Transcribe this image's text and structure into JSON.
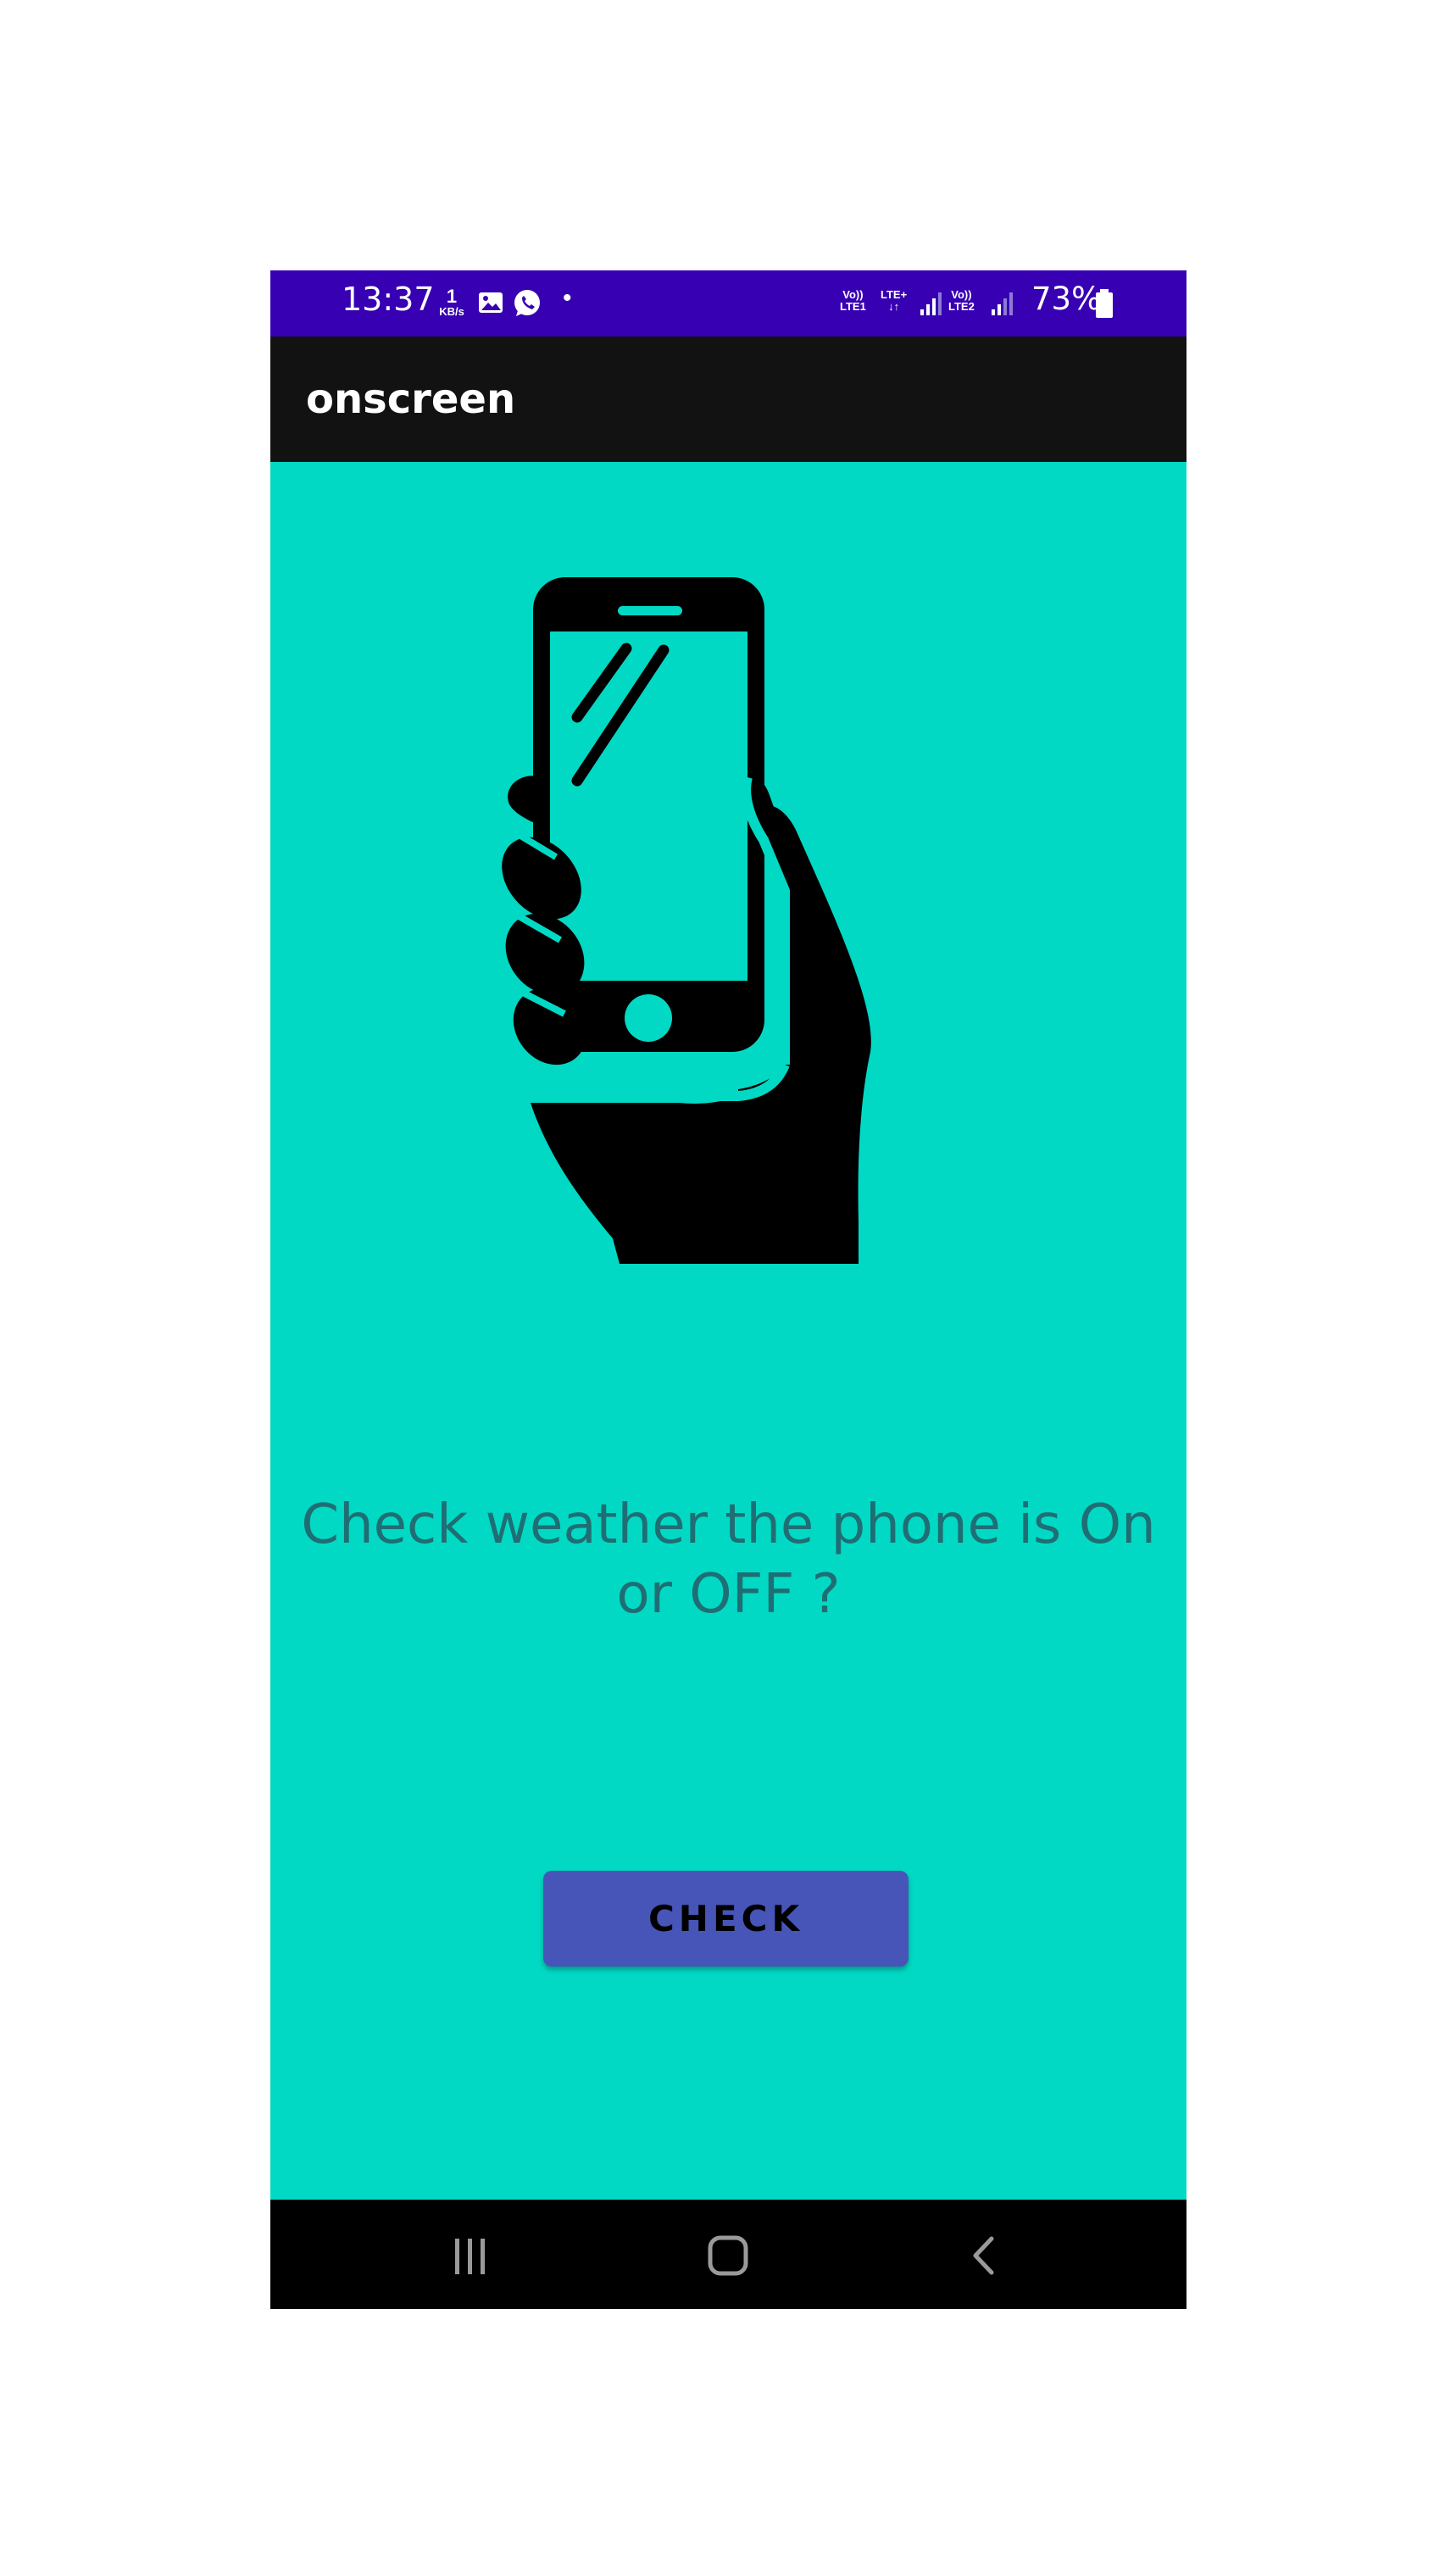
{
  "status_bar": {
    "time": "13:37",
    "net_speed_value": "1",
    "net_speed_unit": "KB/s",
    "sim1_volte": "Vo))",
    "sim1_label": "LTE1",
    "lte_plus": "LTE+",
    "sim2_volte": "Vo))",
    "sim2_label": "LTE2",
    "battery_percent": "73%",
    "colors": {
      "background": "#3700B3",
      "text": "#FFFFFF"
    },
    "icons": [
      "gallery-icon",
      "whatsapp-icon",
      "notification-dot-icon",
      "data-arrows-icon",
      "signal-icon",
      "battery-icon"
    ]
  },
  "app_bar": {
    "title": "onscreen",
    "background": "#121212"
  },
  "main": {
    "background": "#02D9C4",
    "illustration": "hand-holding-phone-icon",
    "prompt_text": "Check weather the phone is On or OFF ?",
    "check_button_label": "CHECK",
    "button_color": "#4655B7"
  },
  "nav_bar": {
    "buttons": [
      "recent-apps-icon",
      "home-icon",
      "back-icon"
    ],
    "background": "#000000"
  }
}
